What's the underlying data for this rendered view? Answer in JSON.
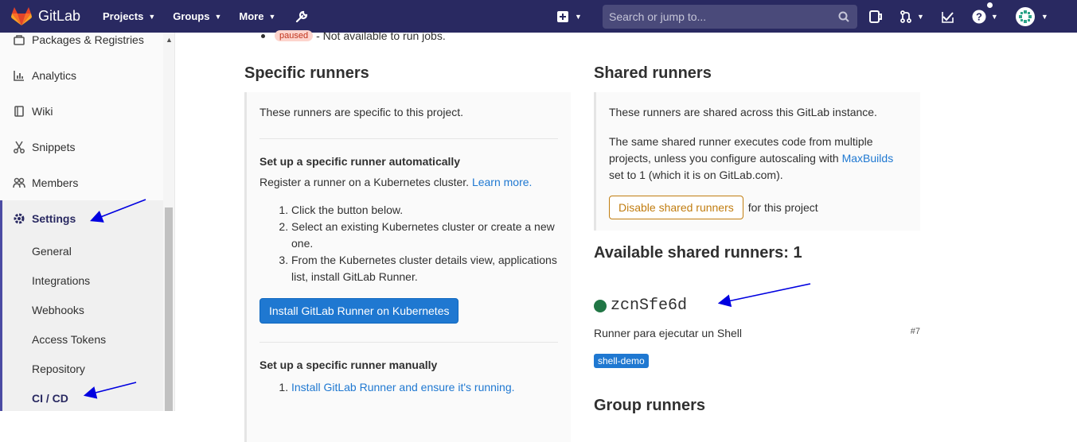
{
  "navbar": {
    "brand": "GitLab",
    "menu": [
      {
        "label": "Projects"
      },
      {
        "label": "Groups"
      },
      {
        "label": "More"
      }
    ],
    "search_placeholder": "Search or jump to..."
  },
  "sidebar": {
    "items": [
      {
        "label": "Packages & Registries"
      },
      {
        "label": "Analytics"
      },
      {
        "label": "Wiki"
      },
      {
        "label": "Snippets"
      },
      {
        "label": "Members"
      }
    ],
    "settings_label": "Settings",
    "sub_items": [
      {
        "label": "General"
      },
      {
        "label": "Integrations"
      },
      {
        "label": "Webhooks"
      },
      {
        "label": "Access Tokens"
      },
      {
        "label": "Repository"
      },
      {
        "label": "CI / CD"
      }
    ]
  },
  "main": {
    "paused_badge": "paused",
    "paused_text": "- Not available to run jobs.",
    "specific": {
      "title": "Specific runners",
      "intro": "These runners are specific to this project.",
      "auto_heading": "Set up a specific runner automatically",
      "auto_text": "Register a runner on a Kubernetes cluster.",
      "learn_more": "Learn more.",
      "steps": [
        "Click the button below.",
        "Select an existing Kubernetes cluster or create a new one.",
        "From the Kubernetes cluster details view, applications list, install GitLab Runner."
      ],
      "install_button": "Install GitLab Runner on Kubernetes",
      "manual_heading": "Set up a specific runner manually",
      "manual_step1": "Install GitLab Runner and ensure it's running."
    },
    "shared": {
      "title": "Shared runners",
      "intro": "These runners are shared across this GitLab instance.",
      "desc_before": "The same shared runner executes code from multiple projects, unless you configure autoscaling with",
      "desc_link": "MaxBuilds",
      "desc_after": "set to 1 (which it is on GitLab.com).",
      "disable_button": "Disable shared runners",
      "for_project": "for this project",
      "available_title": "Available shared runners: 1",
      "runner": {
        "name": "zcnSfe6d",
        "description": "Runner para ejecutar un Shell",
        "id": "#7",
        "tag": "shell-demo",
        "status_color": "#217645"
      },
      "group_title": "Group runners"
    }
  },
  "colors": {
    "navbar": "#292961",
    "link": "#1f78d1",
    "arrow": "#0000e0"
  }
}
